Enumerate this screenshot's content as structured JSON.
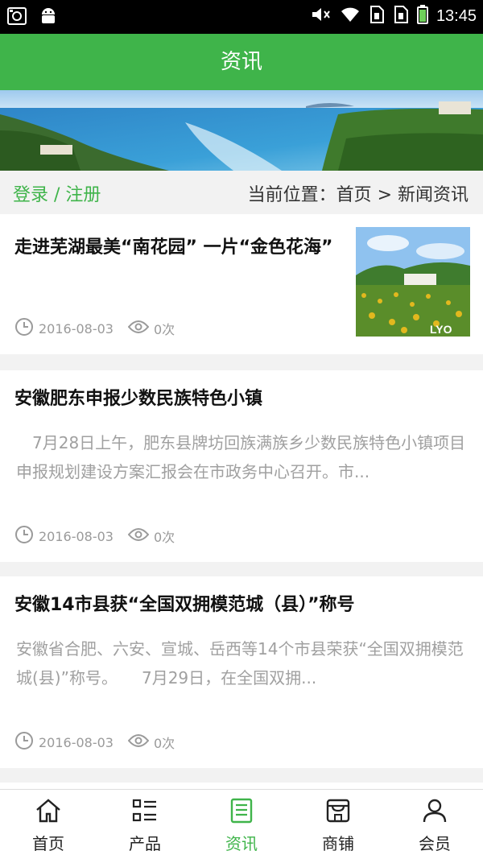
{
  "status_bar": {
    "time": "13:45"
  },
  "header": {
    "title": "资讯"
  },
  "breadcrumb": {
    "login_label": "登录 / 注册",
    "location": "当前位置：首页 > 新闻资讯"
  },
  "articles": [
    {
      "title": "走进芜湖最美“南花园” 一片“金色花海”",
      "date": "2016-08-03",
      "views": "0次",
      "thumb_watermark": "LYO"
    },
    {
      "title": "安徽肥东申报少数民族特色小镇",
      "summary": "　7月28日上午，肥东县牌坊回族满族乡少数民族特色小镇项目申报规划建设方案汇报会在市政务中心召开。市...",
      "date": "2016-08-03",
      "views": "0次"
    },
    {
      "title": "安徽14市县获“全国双拥模范城（县）”称号",
      "summary": "安徽省合肥、六安、宣城、岳西等14个市县荣获“全国双拥模范城(县)”称号。　　7月29日，在全国双拥...",
      "date": "2016-08-03",
      "views": "0次"
    }
  ],
  "bottom_nav": [
    {
      "label": "首页",
      "icon": "home-icon"
    },
    {
      "label": "产品",
      "icon": "product-list-icon"
    },
    {
      "label": "资讯",
      "icon": "news-icon",
      "active": true
    },
    {
      "label": "商铺",
      "icon": "shop-icon"
    },
    {
      "label": "会员",
      "icon": "member-icon"
    }
  ],
  "colors": {
    "accent": "#3fb44a",
    "muted_text": "#a0a0a0",
    "status_bar": "#000000"
  }
}
